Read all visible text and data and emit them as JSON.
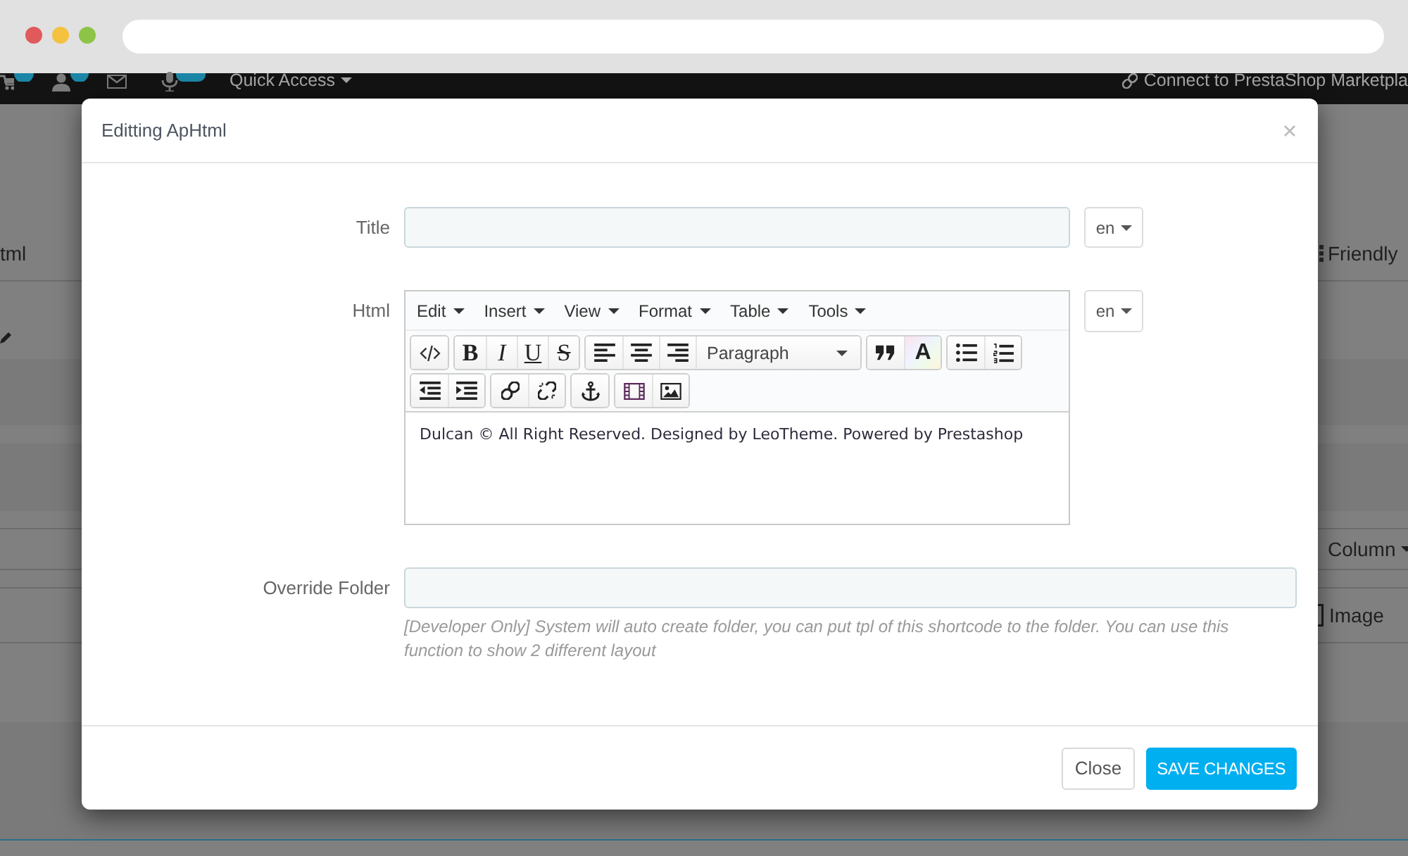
{
  "admin_bar": {
    "quick_access": "Quick Access",
    "marketplace_link": "Connect to PrestaShop Marketpla"
  },
  "page_behind": {
    "left_header": "tml",
    "right_header": "Friendly",
    "column_dropdown": "Column",
    "image_option": "Image"
  },
  "modal": {
    "title": "Editting ApHtml",
    "fields": [
      {
        "kind": "input",
        "label": "Title",
        "language": "en"
      },
      {
        "kind": "editor",
        "label": "Html",
        "language": "en",
        "editor": {
          "menus": [
            "Edit",
            "Insert",
            "View",
            "Format",
            "Table",
            "Tools"
          ],
          "format_letters": {
            "bold": "B",
            "italic": "I",
            "underline": "U",
            "strikethrough": "S",
            "text_color": "A"
          },
          "block_format": "Paragraph",
          "content": "Dulcan © All Right Reserved. Designed by LeoTheme. Powered by Prestashop"
        }
      },
      {
        "kind": "input",
        "label": "Override Folder",
        "help": "[Developer Only] System will auto create folder, you can put tpl of this shortcode to the folder. You can use this function to show 2 different layout"
      }
    ],
    "buttons": [
      {
        "kind": "default",
        "label": "Close"
      },
      {
        "kind": "primary",
        "label": "SAVE CHANGES"
      }
    ]
  }
}
